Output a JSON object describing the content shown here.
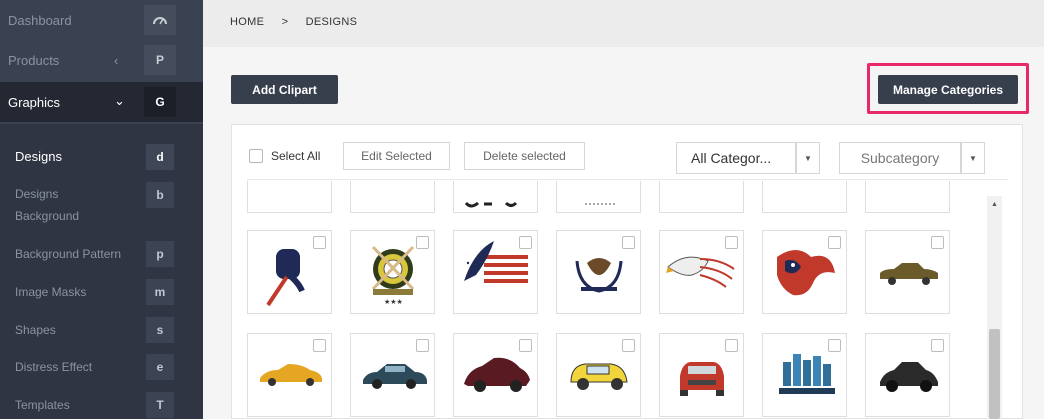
{
  "sidebar": {
    "main": [
      {
        "label": "Dashboard",
        "badge": "",
        "chevron": "",
        "icon": "gauge-icon"
      },
      {
        "label": "Products",
        "badge": "P",
        "chevron": "‹"
      },
      {
        "label": "Graphics",
        "badge": "G",
        "chevron": "⌄"
      }
    ],
    "sub": [
      {
        "label": "Designs",
        "badge": "d"
      },
      {
        "label": "Designs Background",
        "badge": "b"
      },
      {
        "label": "Background Pattern",
        "badge": "p"
      },
      {
        "label": "Image Masks",
        "badge": "m"
      },
      {
        "label": "Shapes",
        "badge": "s"
      },
      {
        "label": "Distress Effect",
        "badge": "e"
      },
      {
        "label": "Templates",
        "badge": "T"
      }
    ]
  },
  "breadcrumb": {
    "home": "HOME",
    "sep": ">",
    "current": "DESIGNS"
  },
  "actions": {
    "add_clipart": "Add Clipart",
    "manage_categories": "Manage Categories"
  },
  "toolbar": {
    "select_all": "Select All",
    "edit_selected": "Edit Selected",
    "delete_selected": "Delete selected",
    "category_value": "All Categor...",
    "subcategory_placeholder": "Subcategory"
  },
  "designs": {
    "row1": [
      "baseball-bat-glove",
      "baseball-emblem",
      "eagle-flag",
      "eagle-wreath",
      "eagle-head-flag",
      "tribal-eagle",
      "vintage-car"
    ],
    "row2": [
      "sports-car-yellow",
      "sedan-blue",
      "classic-car-red",
      "cartoon-car",
      "car-front-red",
      "city-skyline-car",
      "hot-rod-black"
    ]
  },
  "colors": {
    "sidebar": "#2f3542",
    "accent_highlight": "#e9276b",
    "dark_button": "#373e4c"
  }
}
